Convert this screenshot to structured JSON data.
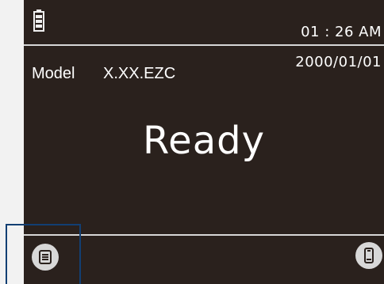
{
  "status_bar": {
    "battery_icon": "battery-icon",
    "time": "01 : 26 AM",
    "date": "2000/01/01"
  },
  "info": {
    "model_label": "Model",
    "model_value": "X.XX.EZC"
  },
  "main": {
    "status": "Ready"
  },
  "bottom_bar": {
    "menu_icon": "menu-icon",
    "device_icon": "device-icon"
  },
  "colors": {
    "screen_bg": "#2a211d",
    "text": "#ffffff",
    "divider": "#d7d7d7",
    "button": "#d8d8d8",
    "highlight": "#123f73"
  }
}
